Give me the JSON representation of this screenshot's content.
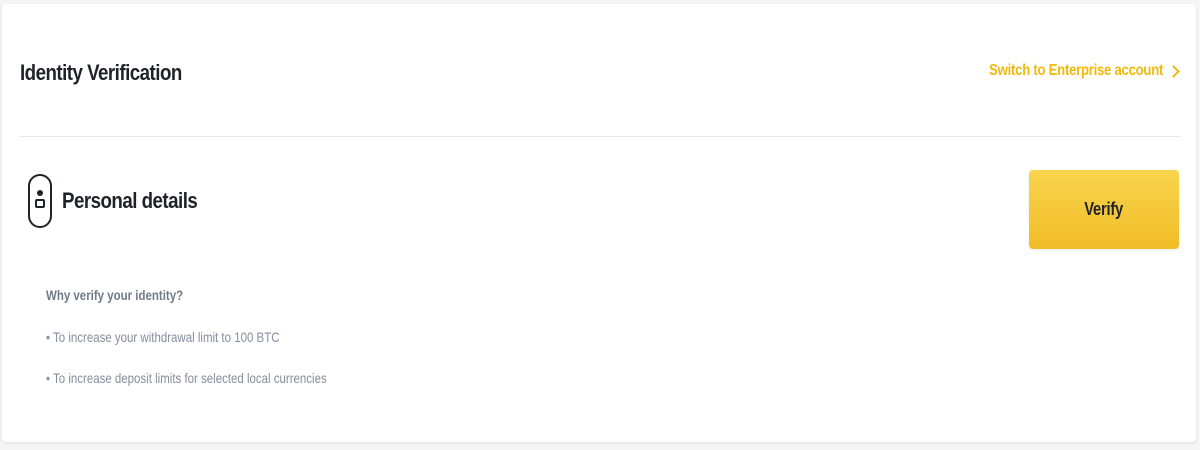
{
  "header": {
    "title": "Identity Verification",
    "switch_link": "Switch to Enterprise account"
  },
  "section": {
    "title": "Personal details",
    "verify_button": "Verify"
  },
  "why": {
    "heading": "Why verify your identity?",
    "items": [
      "• To increase your withdrawal limit to 100 BTC",
      "• To increase deposit limits for selected local currencies"
    ]
  },
  "colors": {
    "accent": "#f0b90b",
    "button_yellow": "#f0c230",
    "text_dark": "#1e2329",
    "text_muted": "#848e9c"
  },
  "icons": [
    "chevron-right-icon",
    "person-icon"
  ]
}
